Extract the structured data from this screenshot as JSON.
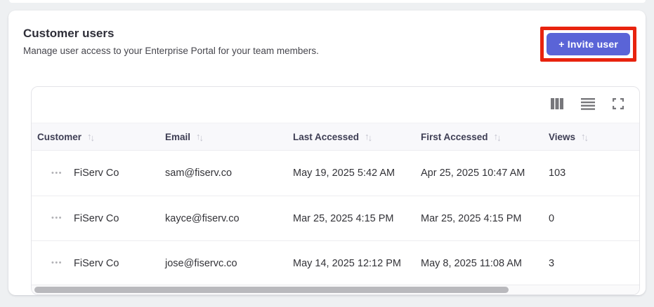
{
  "card": {
    "title": "Customer users",
    "subtitle": "Manage user access to your Enterprise Portal for your team members."
  },
  "invite_button": {
    "label": "+ Invite user",
    "background": "#5a64d7",
    "annotation_highlight_color": "#e8230e"
  },
  "toolbar": {
    "icons": [
      {
        "name": "show-hide-columns-icon"
      },
      {
        "name": "row-density-icon"
      },
      {
        "name": "fullscreen-icon"
      }
    ]
  },
  "table": {
    "columns": [
      {
        "label": "Customer",
        "sortable": true
      },
      {
        "label": "Email",
        "sortable": true
      },
      {
        "label": "Last Accessed",
        "sortable": true
      },
      {
        "label": "First Accessed",
        "sortable": true
      },
      {
        "label": "Views",
        "sortable": true
      }
    ],
    "rows": [
      {
        "customer": "FiServ Co",
        "email": "sam@fiserv.co",
        "last_accessed": "May 19, 2025 5:42 AM",
        "first_accessed": "Apr 25, 2025 10:47 AM",
        "views": "103"
      },
      {
        "customer": "FiServ Co",
        "email": "kayce@fiserv.co",
        "last_accessed": "Mar 25, 2025 4:15 PM",
        "first_accessed": "Mar 25, 2025 4:15 PM",
        "views": "0"
      },
      {
        "customer": "FiServ Co",
        "email": "jose@fiservc.co",
        "last_accessed": "May 14, 2025 12:12 PM",
        "first_accessed": "May 8, 2025 11:08 AM",
        "views": "3"
      }
    ]
  },
  "scrollbar": {
    "thumb_fraction": 0.78
  }
}
